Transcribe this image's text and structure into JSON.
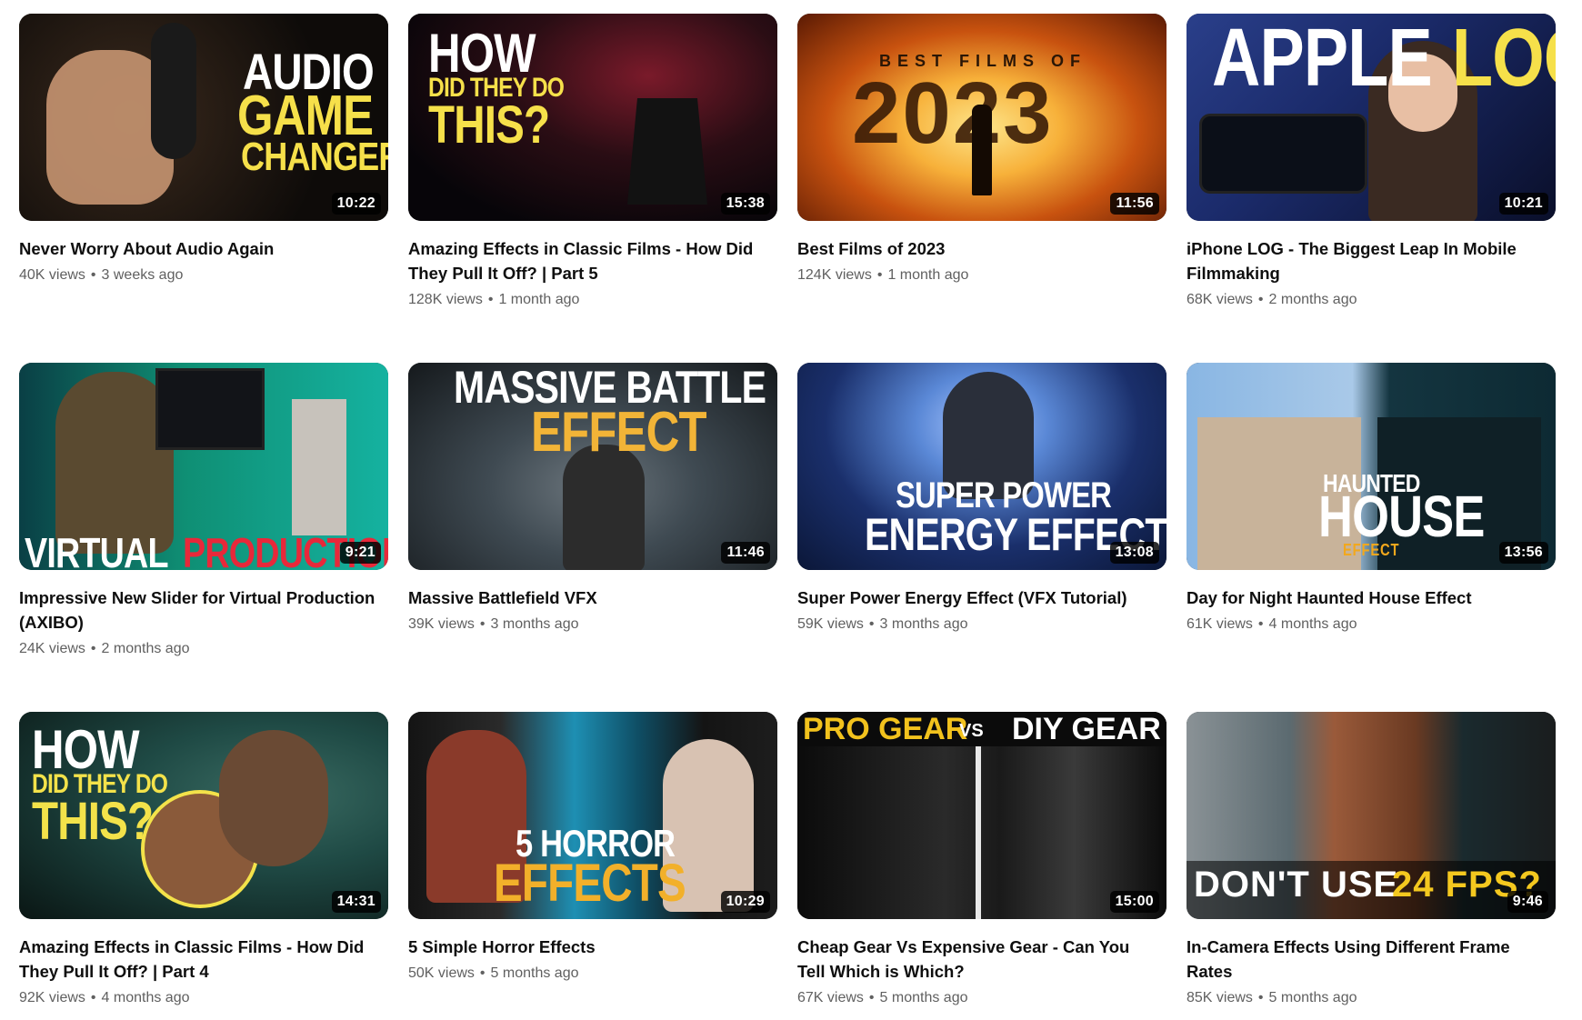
{
  "videos": [
    {
      "title": "Never Worry About Audio Again",
      "views": "40K views",
      "age": "3 weeks ago",
      "duration": "10:22",
      "thumb_text": [
        "AUDIO",
        "GAME",
        "CHANGER"
      ],
      "colors": {
        "bg1": "#3b2a1d",
        "bg2": "#0e0b09",
        "accent": "#f6e04a"
      }
    },
    {
      "title": "Amazing Effects in Classic Films - How Did They Pull It Off? | Part 5",
      "views": "128K views",
      "age": "1 month ago",
      "duration": "15:38",
      "thumb_text": [
        "HOW",
        "DID THEY DO",
        "THIS?"
      ],
      "colors": {
        "bg1": "#2a0d14",
        "bg2": "#070509",
        "accent": "#ffffff"
      }
    },
    {
      "title": "Best Films of 2023",
      "views": "124K views",
      "age": "1 month ago",
      "duration": "11:56",
      "thumb_text": [
        "BEST FILMS OF",
        "2023"
      ],
      "colors": {
        "bg1": "#f7b13a",
        "bg2": "#8a2a05",
        "accent": "#2a1606"
      }
    },
    {
      "title": "iPhone LOG - The Biggest Leap In Mobile Filmmaking",
      "views": "68K views",
      "age": "2 months ago",
      "duration": "10:21",
      "thumb_text": [
        "APPLE",
        "LOG"
      ],
      "colors": {
        "bg1": "#1b2b6b",
        "bg2": "#0a0f2a",
        "accent": "#ffffff"
      }
    },
    {
      "title": "Impressive New Slider for Virtual Production (AXIBO)",
      "views": "24K views",
      "age": "2 months ago",
      "duration": "9:21",
      "thumb_text": [
        "VIRTUAL",
        "PRODUCTION"
      ],
      "colors": {
        "bg1": "#0f8f74",
        "bg2": "#0a3f45",
        "accent": "#e8283a"
      }
    },
    {
      "title": "Massive Battlefield VFX",
      "views": "39K views",
      "age": "3 months ago",
      "duration": "11:46",
      "thumb_text": [
        "MASSIVE BATTLE",
        "EFFECT"
      ],
      "colors": {
        "bg1": "#3f4a52",
        "bg2": "#15191c",
        "accent": "#f2b437"
      }
    },
    {
      "title": "Super Power Energy Effect (VFX Tutorial)",
      "views": "59K views",
      "age": "3 months ago",
      "duration": "13:08",
      "thumb_text": [
        "SUPER POWER",
        "ENERGY EFFECT"
      ],
      "colors": {
        "bg1": "#5a88d6",
        "bg2": "#0b1738",
        "accent": "#ffffff"
      }
    },
    {
      "title": "Day for Night Haunted House Effect",
      "views": "61K views",
      "age": "4 months ago",
      "duration": "13:56",
      "thumb_text": [
        "HAUNTED",
        "HOUSE",
        "EFFECT"
      ],
      "colors": {
        "bg1": "#89b6e3",
        "bg2": "#0d2a33",
        "accent": "#f2a81d"
      }
    },
    {
      "title": "Amazing Effects in Classic Films - How Did They Pull It Off? | Part 4",
      "views": "92K views",
      "age": "4 months ago",
      "duration": "14:31",
      "thumb_text": [
        "HOW",
        "DID THEY DO",
        "THIS?"
      ],
      "colors": {
        "bg1": "#1f4a45",
        "bg2": "#0a1614",
        "accent": "#f3e24a"
      }
    },
    {
      "title": "5 Simple Horror Effects",
      "views": "50K views",
      "age": "5 months ago",
      "duration": "10:29",
      "thumb_text": [
        "5 HORROR",
        "EFFECTS"
      ],
      "colors": {
        "bg1": "#1e8fb3",
        "bg2": "#141414",
        "accent": "#f2b02a"
      }
    },
    {
      "title": "Cheap Gear Vs Expensive Gear - Can You Tell Which is Which?",
      "views": "67K views",
      "age": "5 months ago",
      "duration": "15:00",
      "thumb_text": [
        "PRO GEAR",
        "VS",
        "DIY GEAR"
      ],
      "colors": {
        "bg1": "#2a2a2a",
        "bg2": "#0b0b0b",
        "accent": "#f2c21d"
      }
    },
    {
      "title": "In-Camera Effects Using Different Frame Rates",
      "views": "85K views",
      "age": "5 months ago",
      "duration": "9:46",
      "thumb_text": [
        "DON'T USE",
        "24 FPS?"
      ],
      "colors": {
        "bg1": "#5b6a70",
        "bg2": "#1a1d1e",
        "accent": "#f4c81f"
      }
    }
  ]
}
